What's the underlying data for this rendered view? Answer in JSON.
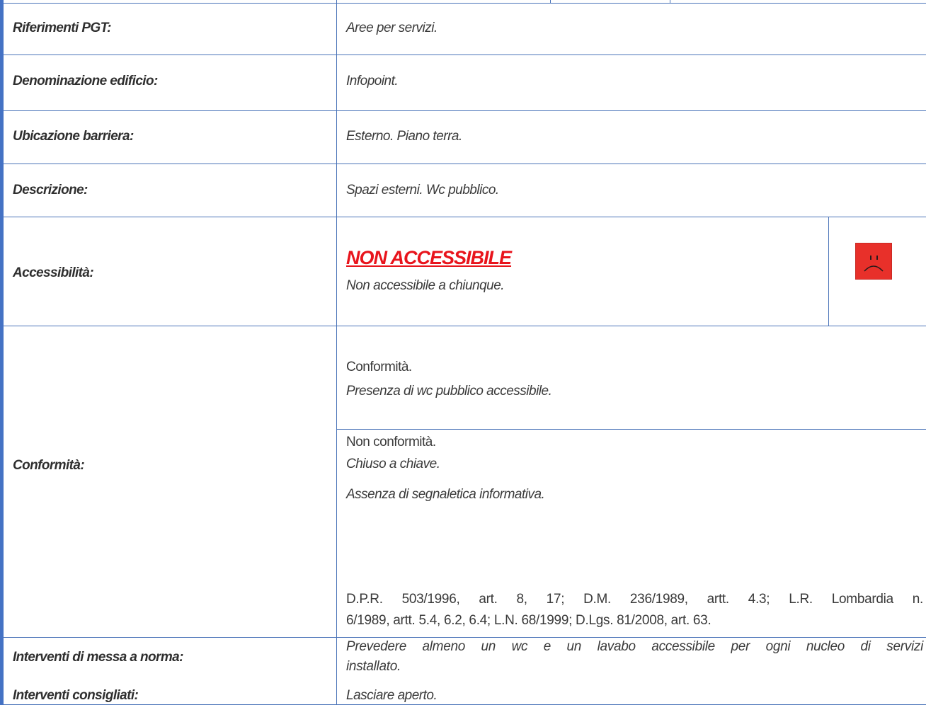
{
  "rows": {
    "riferimenti": {
      "label": "Riferimenti PGT:",
      "value": "Aree per servizi."
    },
    "denominazione": {
      "label": "Denominazione edificio:",
      "value": "Infopoint."
    },
    "ubicazione": {
      "label": "Ubicazione barriera:",
      "value": "Esterno. Piano terra."
    },
    "descrizione": {
      "label": "Descrizione:",
      "value": "Spazi esterni. Wc pubblico."
    },
    "accessibilita": {
      "label": "Accessibilità:",
      "status": "NON ACCESSIBILE",
      "note": "Non accessibile a chiunque.",
      "icon": "sad-face-icon",
      "icon_color": "#e8302a"
    },
    "conformita": {
      "label": "Conformità:",
      "conf_title": "Conformità.",
      "conf_item": "Presenza di wc pubblico accessibile.",
      "nonconf_title": "Non conformità.",
      "nonconf_items": [
        "Chiuso a chiave.",
        "Assenza di segnaletica informativa."
      ],
      "norm_lines": [
        "D.P.R. 503/1996, art. 8, 17; D.M. 236/1989, artt. 4.3; L.R. Lombardia n.",
        "6/1989, artt. 5.4, 6.2, 6.4; L.N. 68/1999; D.Lgs. 81/2008, art. 63."
      ]
    },
    "messa_a_norma": {
      "label": "Interventi di messa a norma:",
      "lines": [
        "Prevedere almeno un wc e un lavabo accessibile per ogni nucleo di servizi",
        "installato."
      ]
    },
    "consigliati": {
      "label": "Interventi consigliati:",
      "value": "Lasciare aperto."
    }
  },
  "colors": {
    "border": "#4a73b8",
    "accent_bar": "#4472c4",
    "status_red": "#e8141c"
  }
}
